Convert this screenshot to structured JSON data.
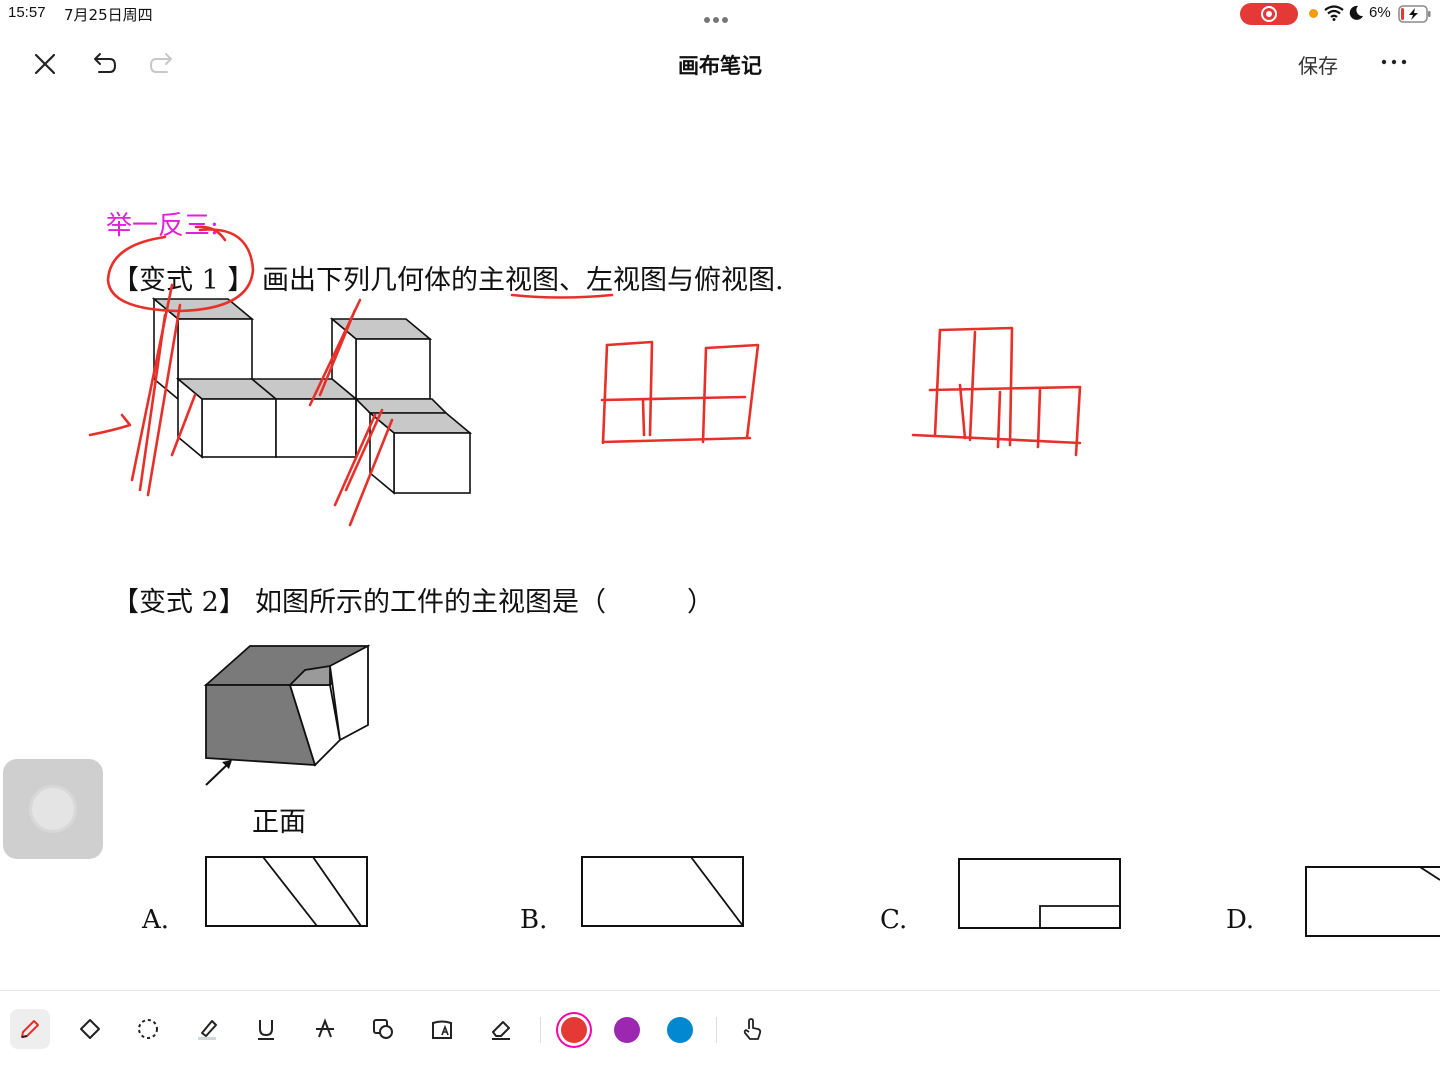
{
  "status": {
    "time": "15:57",
    "date": "7月25日周四",
    "battery": "6%"
  },
  "header": {
    "title": "画布笔记",
    "save_label": "保存"
  },
  "document": {
    "section_heading": "举一反三:",
    "q1_tag": "【变式 1 】",
    "q1_text": "画出下列几何体的主视图、左视图与俯视图.",
    "q2_tag": "【变式 2】",
    "q2_text": "如图所示的工件的主视图是（　　　）",
    "front_label": "正面",
    "options": [
      "A.",
      "B.",
      "C.",
      "D."
    ]
  },
  "toolbar": {
    "tools": [
      "pen-tool",
      "shape-tool",
      "lasso-tool",
      "highlighter-tool",
      "underline-tool",
      "text-tool",
      "shape-recognize-tool",
      "ocr-tool",
      "eraser-tool"
    ],
    "colors": [
      "#e53935",
      "#9c27b0",
      "#0288d1"
    ],
    "ink_color": "#e8302a"
  }
}
